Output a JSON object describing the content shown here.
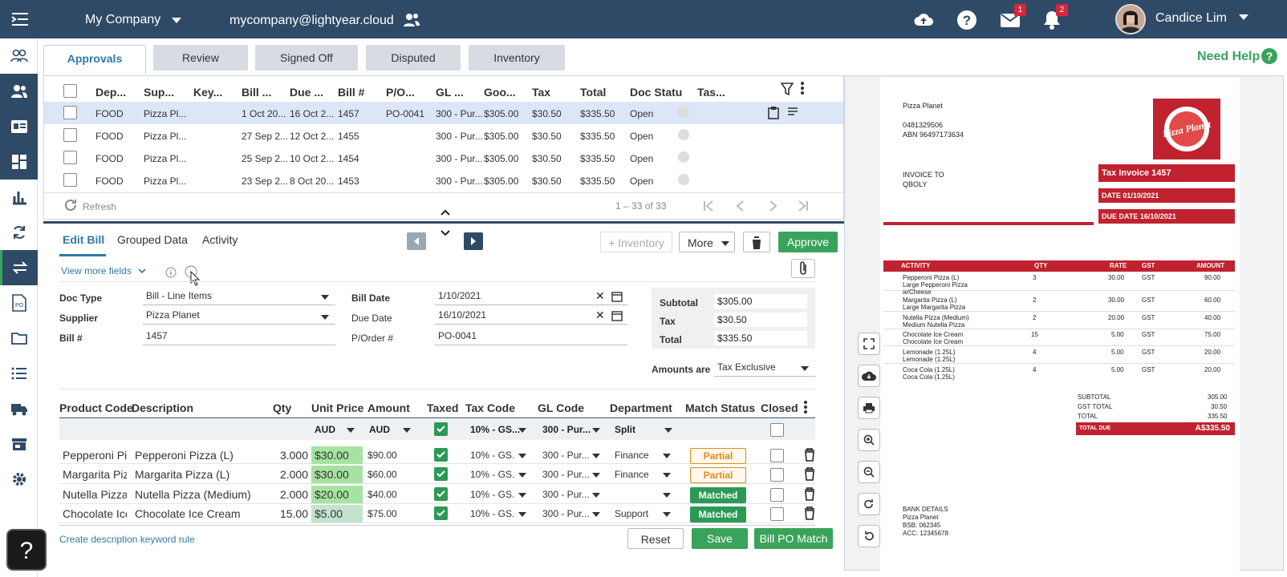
{
  "topbar": {
    "company": "My Company",
    "email": "mycompany@lightyear.cloud",
    "mail_count": "1",
    "notif_count": "2",
    "user_name": "Candice Lim"
  },
  "tabs": [
    "Approvals",
    "Review",
    "Signed Off",
    "Disputed",
    "Inventory"
  ],
  "need_help": "Need Help",
  "list": {
    "headers": [
      "Dep...",
      "Sup...",
      "Key...",
      "Bill ...",
      "Due ...",
      "Bill #",
      "P/O...",
      "GL ...",
      "Goo...",
      "Tax",
      "Total",
      "Doc Statu",
      "Tas..."
    ],
    "rows": [
      {
        "dep": "FOOD",
        "sup": "Pizza Pl...",
        "bill": "1 Oct 20...",
        "due": "16 Oct 2...",
        "num": "1457",
        "po": "PO-0041",
        "gl": "300 - Pur...",
        "goods": "$305.00",
        "tax": "$30.50",
        "total": "$335.50",
        "status": "Open"
      },
      {
        "dep": "FOOD",
        "sup": "Pizza Pl...",
        "bill": "27 Sep 2...",
        "due": "12 Oct 2...",
        "num": "1455",
        "po": "",
        "gl": "300 - Pur...",
        "goods": "$305.00",
        "tax": "$30.50",
        "total": "$335.50",
        "status": "Open"
      },
      {
        "dep": "FOOD",
        "sup": "Pizza Pl...",
        "bill": "25 Sep 2...",
        "due": "10 Oct 2...",
        "num": "1454",
        "po": "",
        "gl": "300 - Pur...",
        "goods": "$305.00",
        "tax": "$30.50",
        "total": "$335.50",
        "status": "Open"
      },
      {
        "dep": "FOOD",
        "sup": "Pizza Pl...",
        "bill": "23 Sep 2...",
        "due": "8 Oct 20...",
        "num": "1453",
        "po": "",
        "gl": "300 - Pur...",
        "goods": "$305.00",
        "tax": "$30.50",
        "total": "$335.50",
        "status": "Open"
      }
    ],
    "refresh": "Refresh",
    "page_info": "1 – 33 of 33"
  },
  "edit": {
    "tabs": [
      "Edit Bill",
      "Grouped Data",
      "Activity"
    ],
    "inventory_btn": "Inventory",
    "more_btn": "More",
    "approve_btn": "Approve",
    "view_more": "View more fields",
    "doc_type_label": "Doc Type",
    "doc_type_value": "Bill - Line Items",
    "supplier_label": "Supplier",
    "supplier_value": "Pizza Planet",
    "bill_num_label": "Bill #",
    "bill_num_value": "1457",
    "bill_date_label": "Bill Date",
    "bill_date_value": "1/10/2021",
    "due_date_label": "Due Date",
    "due_date_value": "16/10/2021",
    "po_label": "P/Order #",
    "po_value": "PO-0041",
    "subtotal_label": "Subtotal",
    "subtotal_value": "$305.00",
    "tax_label": "Tax",
    "tax_value": "$30.50",
    "total_label": "Total",
    "total_value": "$335.50",
    "amounts_are_label": "Amounts are",
    "amounts_are_value": "Tax Exclusive"
  },
  "grid": {
    "headers": [
      "Product Code",
      "Description",
      "Qty",
      "Unit Price",
      "Amount",
      "Taxed",
      "Tax Code",
      "GL Code",
      "Department",
      "Match Status",
      "Closed"
    ],
    "filter": {
      "unit": "AUD",
      "amount": "AUD",
      "tax": "10% - GS...",
      "gl": "300 - Pur...",
      "dept": "Split"
    },
    "rows": [
      {
        "code": "Pepperoni Pi",
        "desc": "Pepperoni Pizza (L)",
        "qty": "3.000",
        "price": "$30.00",
        "amount": "$90.00",
        "tax": "10% - GS...",
        "gl": "300 - Pur...",
        "dept": "Finance",
        "status": "Partial"
      },
      {
        "code": "Margarita Piz",
        "desc": "Margarita Pizza (L)",
        "qty": "2.000",
        "price": "$30.00",
        "amount": "$60.00",
        "tax": "10% - GS...",
        "gl": "300 - Pur...",
        "dept": "Finance",
        "status": "Partial"
      },
      {
        "code": "Nutella Pizza",
        "desc": "Nutella Pizza (Medium)",
        "qty": "2.000",
        "price": "$20.00",
        "amount": "$40.00",
        "tax": "10% - GS...",
        "gl": "300 - Pur...",
        "dept": "",
        "status": "Matched"
      },
      {
        "code": "Chocolate Ice",
        "desc": "Chocolate Ice Cream",
        "qty": "15.00",
        "price": "$5.00",
        "amount": "$75.00",
        "tax": "10% - GS...",
        "gl": "300 - Pur...",
        "dept": "Support",
        "status": "Matched"
      }
    ],
    "keyword_rule": "Create description keyword rule",
    "reset": "Reset",
    "save": "Save",
    "bill_po_match": "Bill PO Match"
  },
  "invoice": {
    "supplier": "Pizza Planet",
    "phone": "0481329506",
    "abn": "ABN 96497173634",
    "logo_text": "Pizza Planet",
    "invoice_to": "INVOICE TO",
    "to_name": "QBOLY",
    "title": "Tax Invoice 1457",
    "date": "DATE 01/10/2021",
    "due": "DUE DATE 16/10/2021",
    "cols": [
      "ACTIVITY",
      "QTY",
      "RATE",
      "GST",
      "AMOUNT"
    ],
    "lines": [
      {
        "a": "Pepperoni Pizza (L)",
        "b": "Large Pepperoni Pizza",
        "c": "w/Cheese",
        "qty": "3",
        "rate": "30.00",
        "gst": "GST",
        "amt": "90.00"
      },
      {
        "a": "Margarita Pizza (L)",
        "b": "Large Margarita Pizza",
        "c": "",
        "qty": "2",
        "rate": "30.00",
        "gst": "GST",
        "amt": "60.00"
      },
      {
        "a": "Nutella Pizza (Medium)",
        "b": "Medium Nutella Pizza",
        "c": "",
        "qty": "2",
        "rate": "20.00",
        "gst": "GST",
        "amt": "40.00"
      },
      {
        "a": "Chocolate Ice Cream",
        "b": "Chocolate Ice Cream",
        "c": "",
        "qty": "15",
        "rate": "5.00",
        "gst": "GST",
        "amt": "75.00"
      },
      {
        "a": "Lemonade (1.25L)",
        "b": "Lemonade (1.25L)",
        "c": "",
        "qty": "4",
        "rate": "5.00",
        "gst": "GST",
        "amt": "20.00"
      },
      {
        "a": "Coca Cola (1.25L)",
        "b": "Coca Cola (1.25L)",
        "c": "",
        "qty": "4",
        "rate": "5.00",
        "gst": "GST",
        "amt": "20.00"
      }
    ],
    "subtotal_l": "SUBTOTAL",
    "subtotal_v": "305.00",
    "gst_l": "GST TOTAL",
    "gst_v": "30.50",
    "total_l": "TOTAL",
    "total_v": "335.50",
    "due_l": "TOTAL DUE",
    "due_v": "A$335.50",
    "bank_title": "BANK DETAILS",
    "bank_name": "Pizza Planet",
    "bsb": "BSB: 062345",
    "acc": "ACC: 12345678"
  },
  "colors": {
    "nav": "#2f4a66",
    "accent": "#3aa35b",
    "invoice_red": "#c0222f"
  }
}
